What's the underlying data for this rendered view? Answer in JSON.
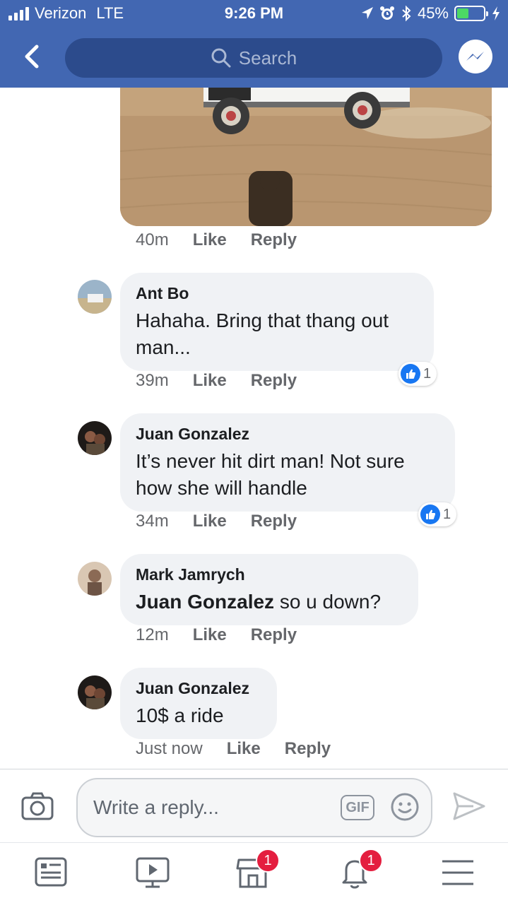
{
  "status_bar": {
    "carrier": "Verizon",
    "network": "LTE",
    "time": "9:26 PM",
    "battery_percent": "45%",
    "battery_level": 0.45,
    "icons": [
      "location-icon",
      "alarm-icon",
      "bluetooth-icon",
      "battery-icon",
      "charging-icon"
    ]
  },
  "nav": {
    "search_placeholder": "Search",
    "icons": [
      "back-icon",
      "search-icon",
      "messenger-icon"
    ]
  },
  "comments": [
    {
      "author": "",
      "text": "",
      "time": "40m",
      "like_label": "Like",
      "reply_label": "Reply",
      "reaction_count": null
    },
    {
      "author": "Ant Bo",
      "text": "Hahaha. Bring that thang out man...",
      "time": "39m",
      "like_label": "Like",
      "reply_label": "Reply",
      "reaction_count": "1"
    },
    {
      "author": "Juan Gonzalez",
      "text": "It’s never hit dirt man! Not sure how she will handle",
      "time": "34m",
      "like_label": "Like",
      "reply_label": "Reply",
      "reaction_count": "1"
    },
    {
      "author": "Mark Jamrych",
      "mention": "Juan Gonzalez",
      "text": " so u down?",
      "time": "12m",
      "like_label": "Like",
      "reply_label": "Reply",
      "reaction_count": null
    },
    {
      "author": "Juan Gonzalez",
      "text": "10$ a ride",
      "time": "Just now",
      "like_label": "Like",
      "reply_label": "Reply",
      "reaction_count": null
    }
  ],
  "composer": {
    "placeholder": "Write a reply...",
    "gif_label": "GIF"
  },
  "tabs": [
    {
      "name": "news-feed",
      "badge": null
    },
    {
      "name": "watch",
      "badge": null
    },
    {
      "name": "marketplace",
      "badge": "1"
    },
    {
      "name": "notifications",
      "badge": "1"
    },
    {
      "name": "menu",
      "badge": null
    }
  ],
  "colors": {
    "brand": "#4267b2",
    "like_blue": "#1877f2",
    "badge_red": "#e41e3f",
    "bubble_bg": "#f0f2f5"
  }
}
